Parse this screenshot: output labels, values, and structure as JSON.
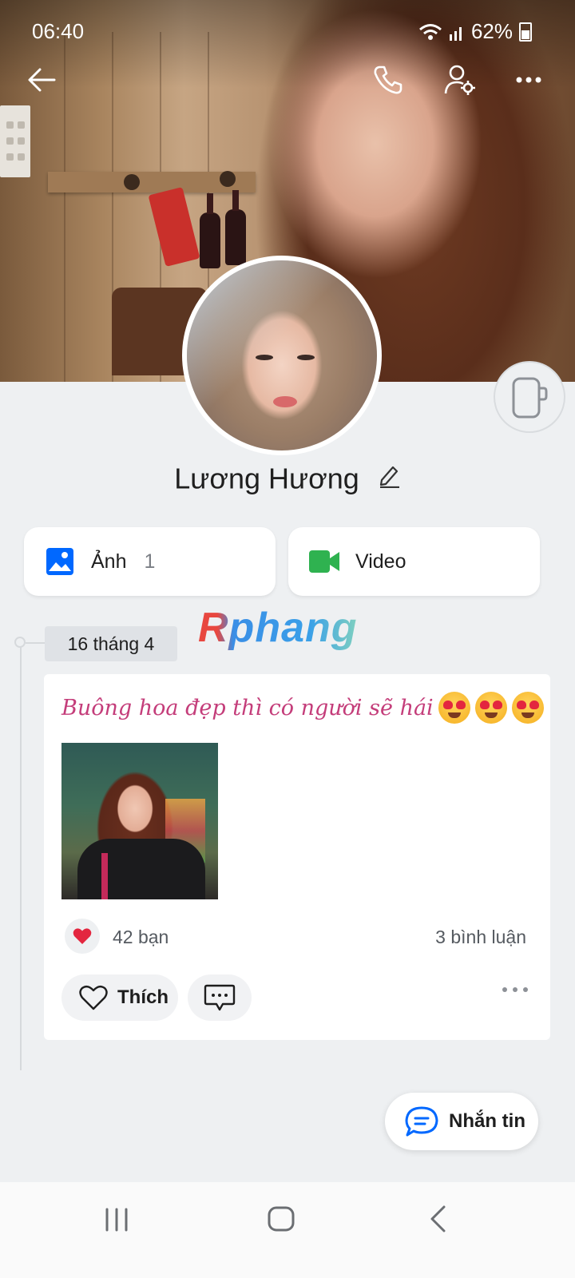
{
  "status_bar": {
    "time": "06:40",
    "battery": "62%"
  },
  "profile": {
    "name": "Lương Hương"
  },
  "media": {
    "photos": {
      "label": "Ảnh",
      "count": "1"
    },
    "video": {
      "label": "Video"
    }
  },
  "watermark": "Rphang",
  "timeline": {
    "date": "16 tháng 4",
    "post": {
      "caption": "Buông hoa đẹp thì có người sẽ hái",
      "likes": "42 bạn",
      "comments": "3 bình luận",
      "like_label": "Thích"
    }
  },
  "message_button": {
    "label": "Nhắn tin"
  },
  "icons": {
    "back": "back-arrow-icon",
    "call": "phone-icon",
    "profile_settings": "user-settings-icon",
    "more": "more-icon",
    "camera": "camera-icon",
    "edit": "pencil-icon",
    "photos": "image-icon",
    "video": "video-camera-icon",
    "heart_reaction": "heart-icon",
    "like": "heart-outline-icon",
    "comment": "comment-icon",
    "message": "chat-bubble-icon"
  },
  "colors": {
    "accent": "#0068ff",
    "video_green": "#2fb250",
    "caption_pink": "#c43d7a",
    "heart_red": "#e3263f"
  }
}
